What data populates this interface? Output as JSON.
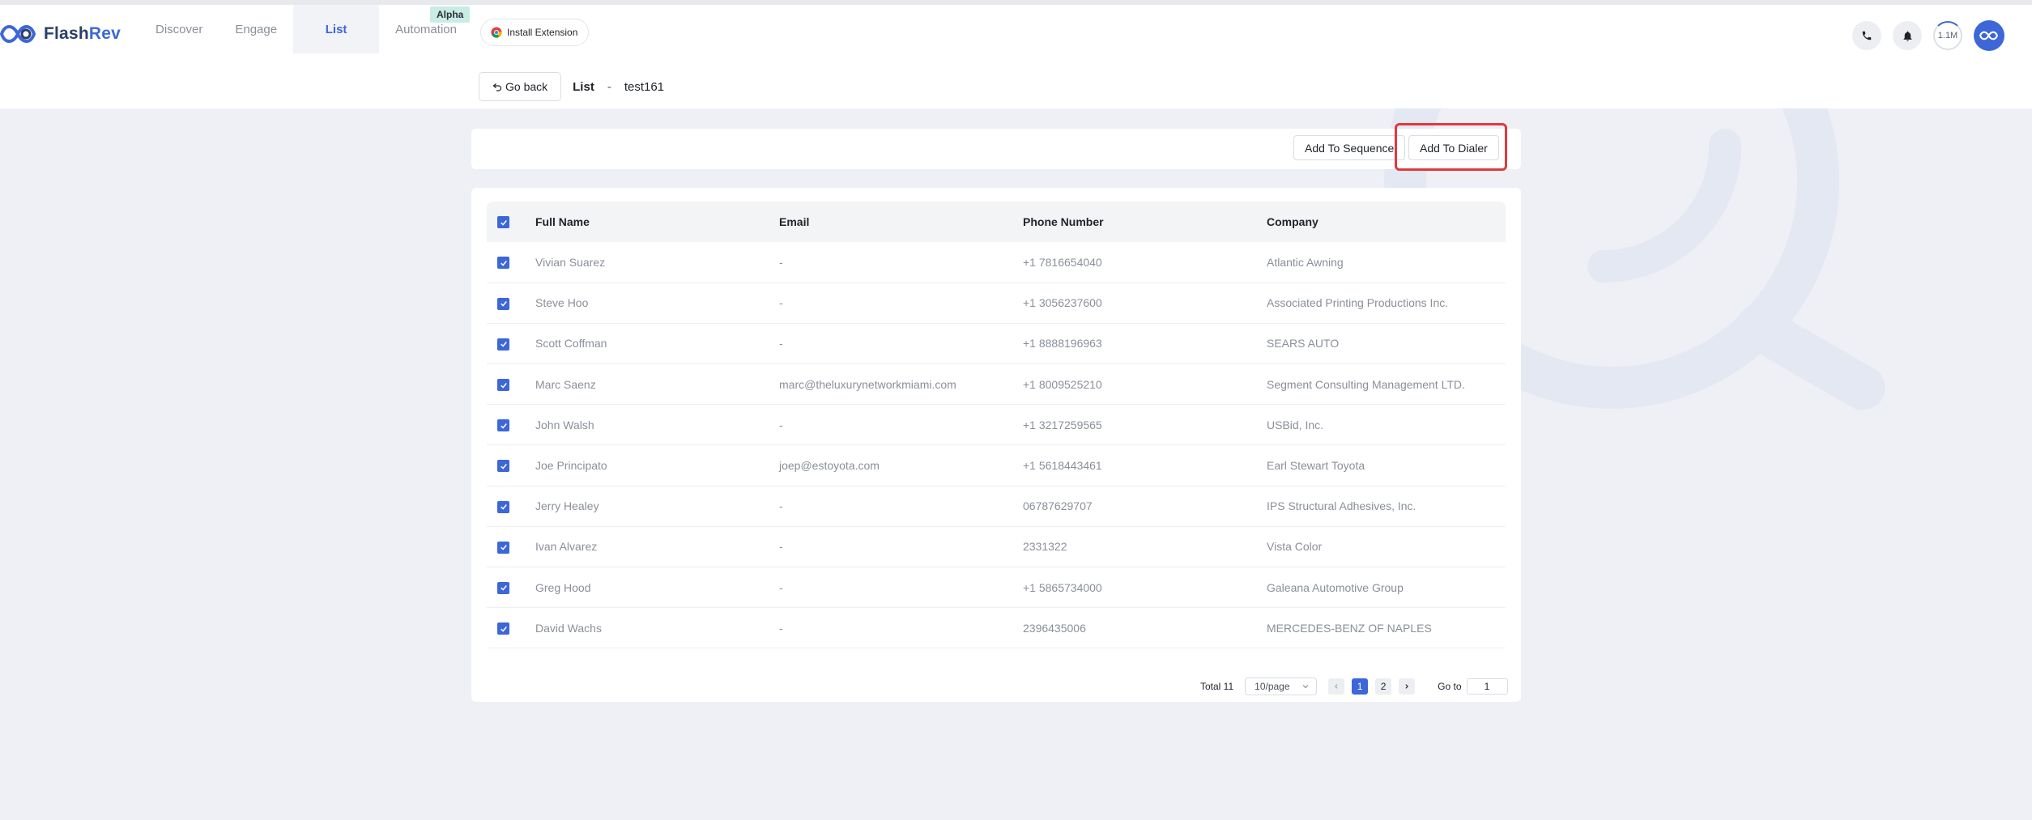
{
  "app": {
    "brand_prefix": "Flash",
    "brand_suffix": "Rev"
  },
  "nav": {
    "items": [
      {
        "label": "Discover"
      },
      {
        "label": "Engage"
      },
      {
        "label": "List"
      },
      {
        "label": "Automation"
      }
    ],
    "alpha_badge": "Alpha",
    "install_extension": "Install Extension"
  },
  "header_right": {
    "credits": "1.1M"
  },
  "subbar": {
    "go_back": "Go back",
    "section": "List",
    "separator": "-",
    "list_name": "test161"
  },
  "actions": {
    "add_to_sequence": "Add To Sequence",
    "add_to_dialer": "Add To Dialer"
  },
  "table": {
    "columns": [
      "Full Name",
      "Email",
      "Phone Number",
      "Company"
    ],
    "rows": [
      {
        "name": "Vivian Suarez",
        "email": "-",
        "phone": "+1 7816654040",
        "company": "Atlantic Awning"
      },
      {
        "name": "Steve Hoo",
        "email": "-",
        "phone": "+1 3056237600",
        "company": "Associated Printing Productions Inc."
      },
      {
        "name": "Scott Coffman",
        "email": "-",
        "phone": "+1 8888196963",
        "company": "SEARS AUTO"
      },
      {
        "name": "Marc Saenz",
        "email": "marc@theluxurynetworkmiami.com",
        "phone": "+1 8009525210",
        "company": "Segment Consulting Management LTD."
      },
      {
        "name": "John Walsh",
        "email": "-",
        "phone": "+1 3217259565",
        "company": "USBid, Inc."
      },
      {
        "name": "Joe Principato",
        "email": "joep@estoyota.com",
        "phone": "+1 5618443461",
        "company": "Earl Stewart Toyota"
      },
      {
        "name": "Jerry Healey",
        "email": "-",
        "phone": "06787629707",
        "company": "IPS Structural Adhesives, Inc."
      },
      {
        "name": "Ivan Alvarez",
        "email": "-",
        "phone": "2331322",
        "company": "Vista Color"
      },
      {
        "name": "Greg Hood",
        "email": "-",
        "phone": "+1 5865734000",
        "company": "Galeana Automotive Group"
      },
      {
        "name": "David Wachs",
        "email": "-",
        "phone": "2396435006",
        "company": "MERCEDES-BENZ OF NAPLES"
      }
    ]
  },
  "pagination": {
    "total": "Total 11",
    "page_size": "10/page",
    "pages": [
      "1",
      "2"
    ],
    "current_page": "1",
    "goto_label": "Go to",
    "goto_value": "1"
  },
  "colors": {
    "accent": "#3d67d8",
    "highlight": "#e0393e",
    "alpha_badge": "#c9ece4"
  }
}
